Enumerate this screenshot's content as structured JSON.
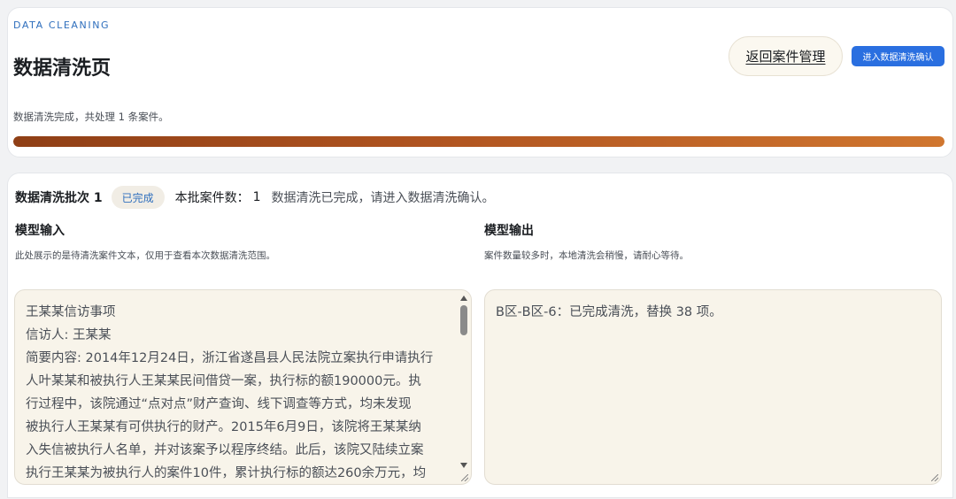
{
  "header": {
    "eyebrow": "DATA CLEANING",
    "title": "数据清洗页",
    "back_button": "返回案件管理",
    "confirm_button": "进入数据清洗确认",
    "status": "数据清洗完成，共处理 1 条案件。",
    "progress_percent": 100
  },
  "batch": {
    "title": "数据清洗批次 1",
    "badge": "已完成",
    "count_label": "本批案件数：",
    "count_value": "1",
    "message": "数据清洗已完成，请进入数据清洗确认。"
  },
  "model_input": {
    "title": "模型输入",
    "description": "此处展示的是待清洗案件文本，仅用于查看本次数据清洗范围。",
    "lines": [
      "王某某信访事项",
      "信访人: 王某某",
      "简要内容: 2014年12月24日，浙江省遂昌县人民法院立案执行申请执行",
      "人叶某某和被执行人王某某民间借贷一案，执行标的额190000元。执",
      "行过程中，该院通过“点对点”财产查询、线下调查等方式，均未发现",
      "被执行人王某某有可供执行的财产。2015年6月9日，该院将王某某纳",
      "入失信被执行人名单，并对该案予以程序终结。此后，该院又陆续立案",
      "执行王某某为被执行人的案件10件，累计执行标的额达260余万元，均"
    ]
  },
  "model_output": {
    "title": "模型输出",
    "description": "案件数量较多时，本地清洗会稍慢，请耐心等待。",
    "text": "B区-B区-6：已完成清洗，替换 38 项。"
  }
}
